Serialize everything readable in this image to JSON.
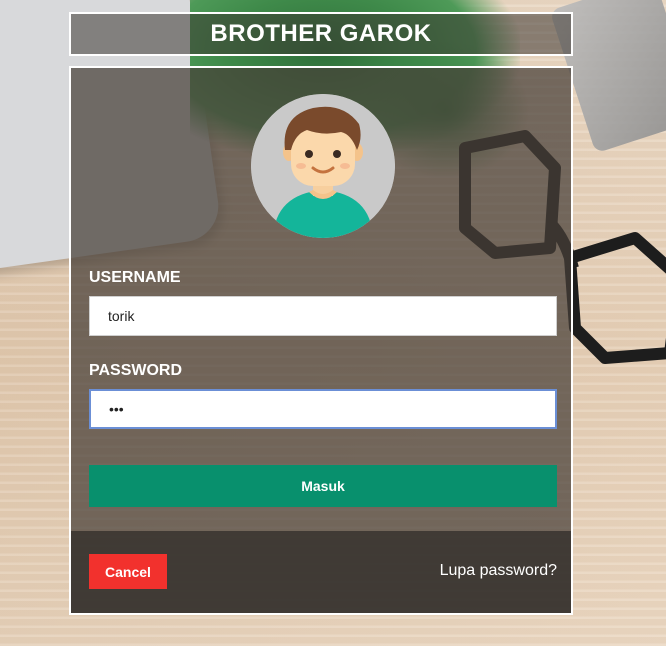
{
  "header": {
    "title": "BROTHER GAROK"
  },
  "login": {
    "avatar_icon": "user-avatar-icon",
    "username_label": "USERNAME",
    "username_value": "torik",
    "password_label": "PASSWORD",
    "password_value": "•••",
    "submit_label": "Masuk",
    "cancel_label": "Cancel",
    "forgot_label": "Lupa password?"
  },
  "colors": {
    "submit": "#08906d",
    "cancel": "#f2312d",
    "focus_border": "#6b8fd6"
  }
}
